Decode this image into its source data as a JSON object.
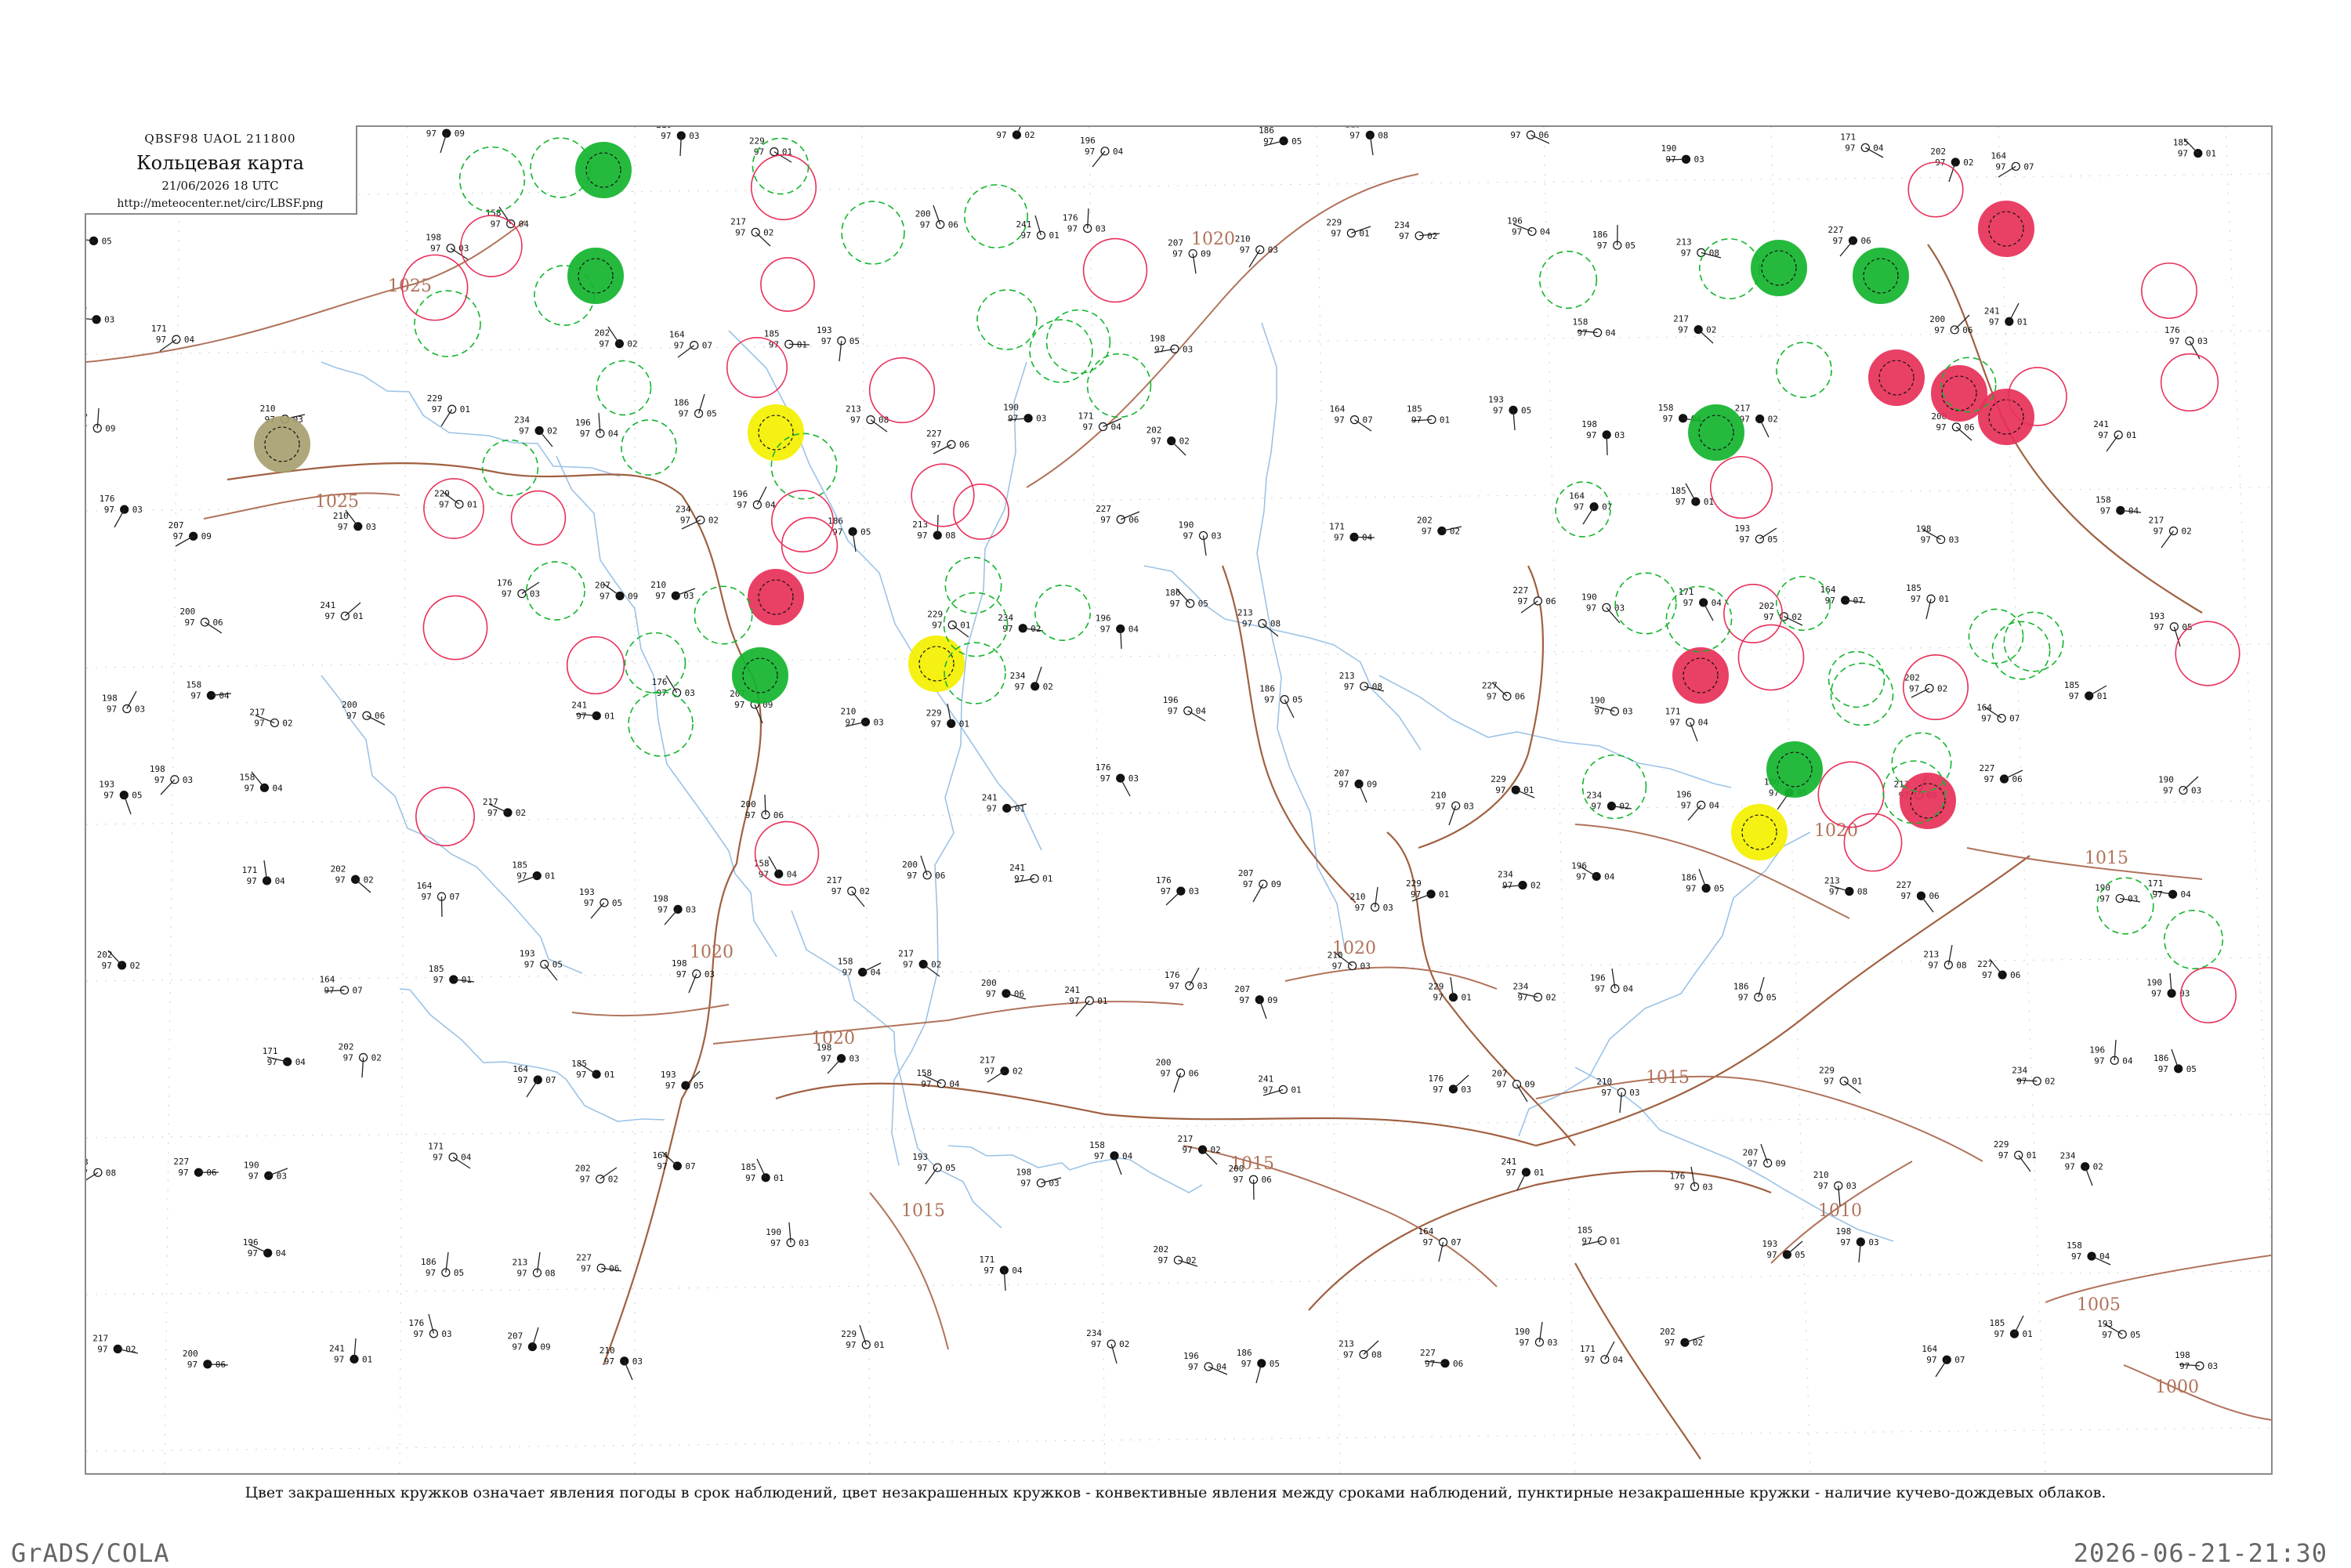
{
  "header": {
    "codes": "QBSF98  UAOL  211800",
    "title": "Кольцевая карта",
    "datetime": "21/06/2026 18 UTC",
    "url": "http://meteocenter.net/circ/LBSF.png"
  },
  "caption": "Цвет закрашенных кружков означает явления погоды в срок наблюдений, цвет незакрашенных кружков - конвективные явления между сроками наблюдений, пунктирные незакрашенные кружки - наличие кучево-дождевых облаков.",
  "footer": {
    "left": "GrADS/COLA",
    "right": "2026-06-21-21:30"
  },
  "colors": {
    "frame": "#8a8a8a",
    "isobar": "#b0735a",
    "river": "#9cc3e6",
    "border": "#a06040",
    "red": "#e8305a",
    "green": "#13b52e",
    "yellow": "#f5f000",
    "olive": "#a8a070"
  },
  "map": {
    "isobar_labels": [
      "1025",
      "1025",
      "1020",
      "1020",
      "1020",
      "1020",
      "1020",
      "1015",
      "1015",
      "1015",
      "1015",
      "1010",
      "1005",
      "1000"
    ],
    "stations": [
      {
        "p": "207",
        "t": "97",
        "d": "09"
      },
      {
        "p": "210",
        "t": "97",
        "d": "03"
      },
      {
        "p": "229",
        "t": "97",
        "d": "01"
      },
      {
        "p": "234",
        "t": "97",
        "d": "02"
      },
      {
        "p": "196",
        "t": "97",
        "d": "04"
      },
      {
        "p": "186",
        "t": "97",
        "d": "05"
      },
      {
        "p": "213",
        "t": "97",
        "d": "08"
      },
      {
        "p": "227",
        "t": "97",
        "d": "06"
      },
      {
        "p": "190",
        "t": "97",
        "d": "03"
      },
      {
        "p": "171",
        "t": "97",
        "d": "04"
      },
      {
        "p": "202",
        "t": "97",
        "d": "02"
      },
      {
        "p": "164",
        "t": "97",
        "d": "07"
      },
      {
        "p": "185",
        "t": "97",
        "d": "01"
      },
      {
        "p": "193",
        "t": "97",
        "d": "05"
      },
      {
        "p": "198",
        "t": "97",
        "d": "03"
      },
      {
        "p": "158",
        "t": "97",
        "d": "04"
      },
      {
        "p": "217",
        "t": "97",
        "d": "02"
      },
      {
        "p": "200",
        "t": "97",
        "d": "06"
      },
      {
        "p": "241",
        "t": "97",
        "d": "01"
      },
      {
        "p": "176",
        "t": "97",
        "d": "03"
      }
    ],
    "weather_markers": [
      {
        "kind": "filled",
        "color": "green"
      },
      {
        "kind": "filled",
        "color": "green"
      },
      {
        "kind": "filled",
        "color": "green"
      },
      {
        "kind": "filled",
        "color": "green"
      },
      {
        "kind": "filled",
        "color": "green"
      },
      {
        "kind": "filled",
        "color": "green"
      },
      {
        "kind": "filled",
        "color": "green"
      },
      {
        "kind": "filled",
        "color": "red"
      },
      {
        "kind": "filled",
        "color": "red"
      },
      {
        "kind": "filled",
        "color": "red"
      },
      {
        "kind": "filled",
        "color": "red"
      },
      {
        "kind": "filled",
        "color": "red"
      },
      {
        "kind": "filled",
        "color": "red"
      },
      {
        "kind": "filled",
        "color": "red"
      },
      {
        "kind": "filled",
        "color": "yellow"
      },
      {
        "kind": "filled",
        "color": "yellow"
      },
      {
        "kind": "filled",
        "color": "yellow"
      },
      {
        "kind": "filled",
        "color": "olive"
      }
    ]
  }
}
